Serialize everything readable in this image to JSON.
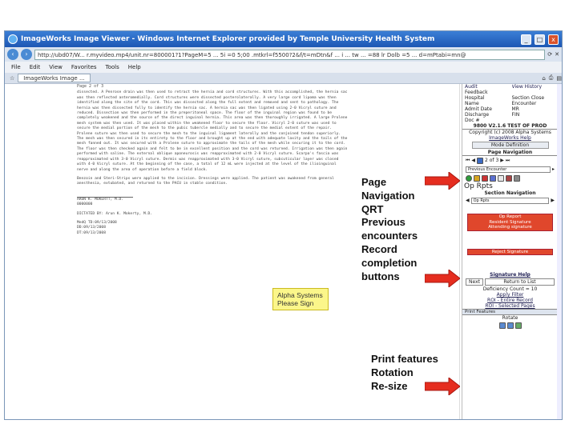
{
  "window": {
    "title": "ImageWorks Image Viewer - Windows Internet Explorer provided by Temple University Health System",
    "url": "http://ubd07/W... r.myvideo.mp4/unit.nr=800001?1?PageM=5 ... 5i =0 5;00 .mtkrl=f5500?2&f/t=mDtn&f ... i ... tw ... =88 lr Dolb =5 ... d=mPtabi=mn@",
    "menu": [
      "File",
      "Edit",
      "View",
      "Favorites",
      "Tools",
      "Help"
    ],
    "tab_label": "ImageWorks Image ..."
  },
  "document": {
    "page_label": "Page 2 of 3",
    "body": "dissected. A Penrose drain was then used to retract the hernia and cord structures. With this accomplished, the hernia sac was then reflected anteromedially. Cord structures were dissected posterolaterally. A very large cord lipoma was then identified along the site of the cord. This was dissected along the full extent and removed and sent to pathology. The hernia was then dissected fully to identify the hernia sac. A hernia sac was then ligated using 2-0 Vicryl suture and reduced. Dissection was then performed in the preperitoneal space. The floor of the inguinal region was found to be completely weakened and the source of the direct inguinal hernia. This area was then thoroughly irrigated. A large Prolene mesh system was then used. It was placed within the weakened floor to secure the floor. Vicryl 2-0 suture was used to secure the medial portion of the mesh to the pubic tubercle medially and to secure the medial extent of the repair. Prolene suture was then used to secure the mesh to the inguinal ligament laterally and the conjoined tendon superiorly. The mesh was then secured in its entirety to the floor and brought up at the end with adequate laxity and the tails of the mesh fanned out. It was secured with a Prolene suture to approximate the tails of the mesh while securing it to the cord. The floor was then checked again and felt to be in excellent position and the cord was returned. Irrigation was then again performed with saline. The external oblique aponeurosis was reapproximated with 2-0 Vicryl suture. Scarpa's fascia was reapproximated with 3-0 Vicryl suture. Dermis was reapproximated with 3-0 Vicryl suture, subcuticular layer was closed with 4-0 Vicryl suture. At the beginning of the case, a total of 12 mL were injected at the level of the ilioinguinal nerve and along the area of operation before a field block.",
    "body2": "Benzoin and Steri-Strips were applied to the incision. Dressings were applied. The patient was awakened from general anesthesia, extubated, and returned to the PACU in stable condition.",
    "sig_name": "ARUN K. MOKERTT, M.D.",
    "sig_id": "0000000",
    "dictated": "DICTATED BY:  Arun K. Mokerty, M.D.",
    "meta1": "MedQ  TD:09/13/2008",
    "meta2": "DD:09/13/2008",
    "meta3": "DT:09/13/2008"
  },
  "sticky": {
    "line1": "Alpha Systems",
    "line2": "Please Sign"
  },
  "sidebar": {
    "top_rows": [
      [
        "Audit",
        "View History"
      ],
      [
        "Feedback",
        ""
      ],
      [
        "Hospital",
        "Section Close"
      ],
      [
        "Name",
        "Encounter"
      ],
      [
        "Admit Date",
        "MR"
      ],
      [
        "Discharge",
        "FIN"
      ],
      [
        "Doc #",
        ""
      ]
    ],
    "version": "9800 V2.1.6 TEST OF PROD",
    "copyright": "Copyright (c) 2008 Alpha Systems",
    "help": "ImageWorks Help",
    "mode_btn": "Mode Definition",
    "page_nav_hdr": "Page Navigation",
    "page_counter": "2 of 3",
    "prev_enc": "Previous Encounter",
    "op_rpts": "Op Rpts",
    "section_nav": "Section Navigation",
    "section_select": "Op Rpts",
    "red_box1_l1": "Op Report",
    "red_box1_l2": "Resident Signature",
    "red_box1_l3": "Attending signature",
    "red_box2": "Reject Signature",
    "signature_help": "Signature Help",
    "next": "Next",
    "return_list": "Return to List",
    "deficiency": "Deficiency Count = 10",
    "apply_filter": "Apply Filter",
    "roi_entire": "ROI - Entire Record",
    "roi_selected": "ROI - Selected Pages",
    "print_features": "Print Features",
    "rotate": "Rotate"
  },
  "annotations": {
    "group1": [
      "Page",
      "Navigation",
      "QRT",
      "Previous",
      "encounters",
      "Record",
      "completion",
      "buttons"
    ],
    "group2": [
      "Print features",
      "Rotation",
      "Re-size"
    ]
  },
  "colors": {
    "arrow": "#e52d1f",
    "titlebar": "#1d57b4",
    "sticky": "#fbf68a",
    "red_button": "#e0472c"
  }
}
